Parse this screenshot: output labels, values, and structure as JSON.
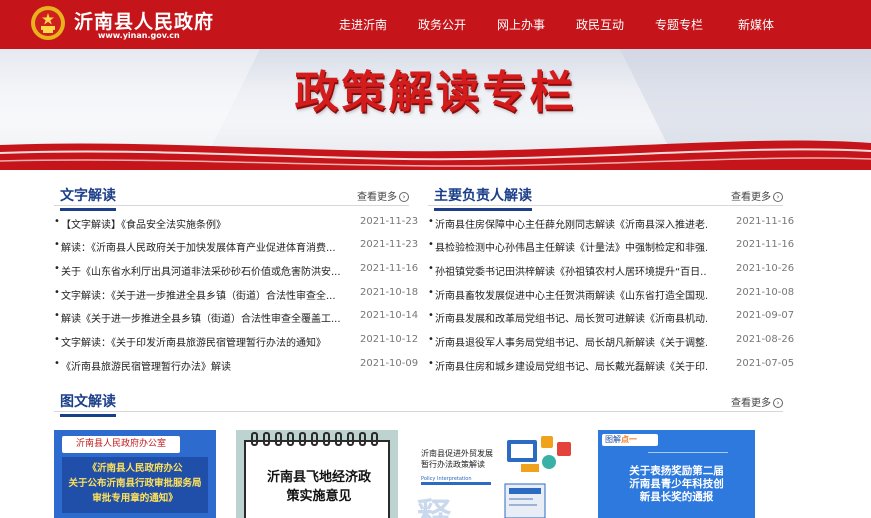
{
  "header": {
    "site_title": "沂南县人民政府",
    "site_url": "www.yinan.gov.cn",
    "nav": [
      "走进沂南",
      "政务公开",
      "网上办事",
      "政民互动",
      "专题专栏",
      "新媒体"
    ]
  },
  "banner": {
    "title": "政策解读专栏"
  },
  "sections": {
    "text_interpretation": {
      "title": "文字解读",
      "more": "查看更多",
      "items": [
        {
          "text": "【文字解读】《食品安全法实施条例》",
          "date": "2021-11-23"
        },
        {
          "text": "解读：《沂南县人民政府关于加快发展体育产业促进体育消费...",
          "date": "2021-11-23"
        },
        {
          "text": "关于《山东省水利厅出具河道非法采砂砂石价值或危害防洪安...",
          "date": "2021-11-16"
        },
        {
          "text": "文字解读：《关于进一步推进全县乡镇（街道）合法性审查全...",
          "date": "2021-10-18"
        },
        {
          "text": "解读《关于进一步推进全县乡镇（街道）合法性审查全覆盖工...",
          "date": "2021-10-14"
        },
        {
          "text": "文字解读：《关于印发沂南县旅游民宿管理暂行办法的通知》",
          "date": "2021-10-12"
        },
        {
          "text": "《沂南县旅游民宿管理暂行办法》解读",
          "date": "2021-10-09"
        }
      ]
    },
    "leader_interpretation": {
      "title": "主要负责人解读",
      "more": "查看更多",
      "items": [
        {
          "text": "沂南县住房保障中心主任薛允刚同志解读《沂南县深入推进老...",
          "date": "2021-11-16"
        },
        {
          "text": "县检验检测中心孙伟昌主任解读《计量法》中强制检定和非强...",
          "date": "2021-11-16"
        },
        {
          "text": "孙祖镇党委书记田洪梓解读《孙祖镇农村人居环境提升“百日...",
          "date": "2021-10-26"
        },
        {
          "text": "沂南县畜牧发展促进中心主任贺洪雨解读《山东省打造全国现...",
          "date": "2021-10-08"
        },
        {
          "text": "沂南县发展和改革局党组书记、局长贺可进解读《沂南县机动...",
          "date": "2021-09-07"
        },
        {
          "text": "沂南县退役军人事务局党组书记、局长胡凡新解读《关于调整...",
          "date": "2021-08-26"
        },
        {
          "text": "沂南县住房和城乡建设局党组书记、局长戴光磊解读《关于印...",
          "date": "2021-07-05"
        }
      ]
    },
    "graphic_interpretation": {
      "title": "图文解读",
      "more": "查看更多",
      "cards": [
        {
          "top_label": "沂南县人民政府办公室",
          "lines": [
            "《沂南县人民政府办公",
            "关于公布沂南县行政审批服务局",
            "审批专用章的通知》"
          ]
        },
        {
          "lines": [
            "沂南县飞地经济政",
            "策实施意见"
          ]
        },
        {
          "lines": [
            "沂南县促进外贸发展",
            "暂行办法政策解读"
          ],
          "sub": "Policy Interpretation",
          "big": "释"
        },
        {
          "tag_a": "图解",
          "tag_b": "点一",
          "lines": [
            "关于表扬奖励第二届",
            "沂南县青少年科技创",
            "新县长奖的通报"
          ]
        }
      ]
    }
  },
  "colors": {
    "header_red": "#c5151a",
    "accent_blue": "#1c3f8a",
    "banner_red": "#d41c1d"
  }
}
